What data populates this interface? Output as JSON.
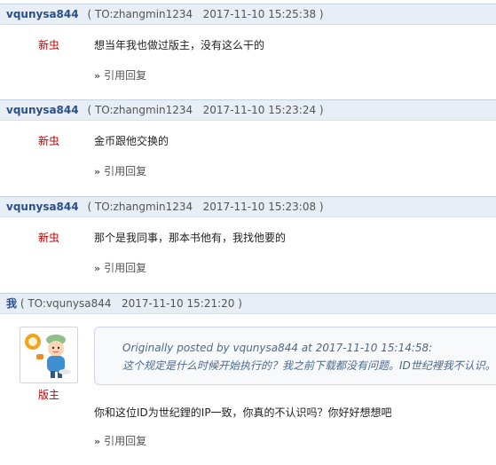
{
  "posts": [
    {
      "author": "vqunysa844",
      "to": "TO:zhangmin1234",
      "time": "2017-11-10 15:25:38",
      "rank": "新虫",
      "content": "想当年我也做过版主，没有这么干的",
      "reply": "引用回复"
    },
    {
      "author": "vqunysa844",
      "to": "TO:zhangmin1234",
      "time": "2017-11-10 15:23:24",
      "rank": "新虫",
      "content": "金币跟他交换的",
      "reply": "引用回复"
    },
    {
      "author": "vqunysa844",
      "to": "TO:zhangmin1234",
      "time": "2017-11-10 15:23:08",
      "rank": "新虫",
      "content": "那个是我同事，那本书他有，我找他要的",
      "reply": "引用回复"
    },
    {
      "author": "我",
      "to": "TO:vqunysa844",
      "time": "2017-11-10 15:21:20",
      "rank": "版主",
      "quote_line1": "Originally posted by vqunysa844 at 2017-11-10 15:14:58:",
      "quote_line2": "这个规定是什么时候开始执行的？我之前下载都没有问题。ID世纪裡我不认识。",
      "content": "你和这位ID为世纪鋰的IP一致，你真的不认识吗？你好好想想吧",
      "reply": "引用回复"
    }
  ],
  "avatar_icon": "mascot-avatar-icon",
  "colors": {
    "header_bg": "#e8eef6",
    "author": "#2b4f8a",
    "rank": "#c00000"
  }
}
